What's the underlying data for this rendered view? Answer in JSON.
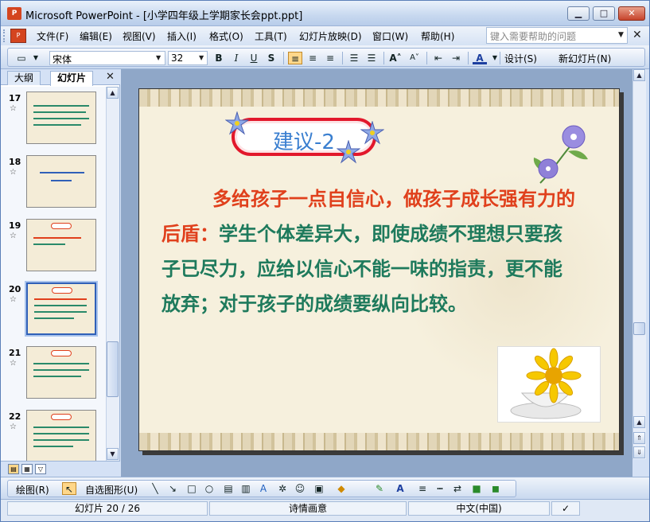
{
  "window": {
    "app_icon": "ppt-icon",
    "title": "Microsoft PowerPoint - [小学四年级上学期家长会ppt.ppt]",
    "controls": [
      "minimize-icon",
      "maximize-icon",
      "close-icon"
    ]
  },
  "menu": {
    "items": [
      "文件(F)",
      "编辑(E)",
      "视图(V)",
      "插入(I)",
      "格式(O)",
      "工具(T)",
      "幻灯片放映(D)",
      "窗口(W)",
      "帮助(H)"
    ],
    "help_placeholder": "键入需要帮助的问题"
  },
  "toolbar": {
    "font_name": "宋体",
    "font_size": "32",
    "bold": "B",
    "italic": "I",
    "underline": "U",
    "shadow": "S",
    "font_color": "A",
    "design_label": "设计(S)",
    "new_slide_label": "新幻灯片(N)"
  },
  "panel": {
    "tabs": [
      "大纲",
      "幻灯片"
    ],
    "active_tab": "幻灯片",
    "slides": [
      {
        "num": "17",
        "selected": false
      },
      {
        "num": "18",
        "selected": false
      },
      {
        "num": "19",
        "selected": false
      },
      {
        "num": "20",
        "selected": true
      },
      {
        "num": "21",
        "selected": false
      },
      {
        "num": "22",
        "selected": false
      }
    ]
  },
  "slide": {
    "title": "建议-2",
    "body_highlight": "多给孩子一点自信心，做孩子成长强有力的后盾：",
    "body_rest": "学生个体差异大，即使成绩不理想只要孩子已尽力，应给以信心不能一味的指责，更不能放弃；对于孩子的成绩要纵向比较。"
  },
  "drawbar": {
    "draw_label": "绘图(R)",
    "autoshape_label": "自选图形(U)"
  },
  "status": {
    "slide_pos": "幻灯片 20 / 26",
    "design_name": "诗情画意",
    "language": "中文(中国)"
  },
  "colors": {
    "title_text": "#3a7fd0",
    "highlight": "#e0401c",
    "body": "#1e7a5c",
    "slide_bg": "#f6f0dd"
  }
}
